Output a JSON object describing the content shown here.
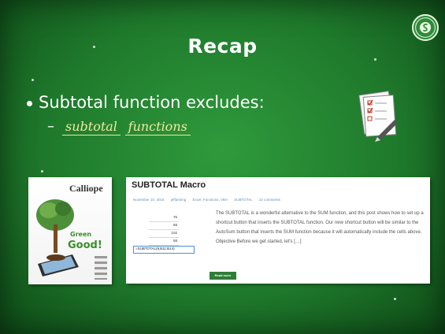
{
  "slide": {
    "title": "Recap",
    "bullet": "Subtotal function excludes:",
    "sub_dash": "–",
    "sub_word1": "subtotal",
    "sub_word2": "functions"
  },
  "magazine": {
    "title": "Calliope",
    "line1": "Green",
    "line2": "Good!"
  },
  "blog": {
    "title": "SUBTOTAL Macro",
    "meta": {
      "date": "November 10, 2015",
      "author": "jeffanning",
      "categories": "Excel, Functions, VBA",
      "tag": "SUBTOTAL",
      "comments": "22 comments"
    },
    "sheet_values": [
      "76",
      "68",
      "102",
      "58"
    ],
    "formula": "=SUBTOTAL(9,B11:B14)",
    "paragraph": "The SUBTOTAL is a wonderful alternative to the SUM function, and this post shows how to set up a shortcut button that inserts the SUBTOTAL function. Our new shortcut button will be similar to the AutoSum button that inserts the SUM function because it will automatically include the cells above. Objective Before we get started, let's […]",
    "read_more": "Read more"
  },
  "icons": {
    "logo": "seal-logo-icon",
    "notepad": "checklist-notepad-icon"
  },
  "colors": {
    "background": "#1f7a2c",
    "handwriting": "#f2e9a0",
    "button": "#2f7d37"
  }
}
